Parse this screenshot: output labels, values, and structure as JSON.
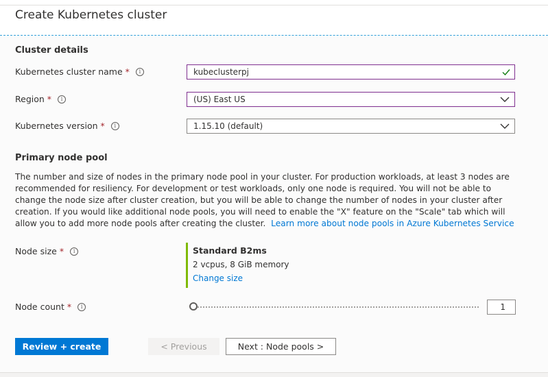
{
  "header": {
    "title": "Create Kubernetes cluster"
  },
  "cluster_details": {
    "section_title": "Cluster details",
    "name": {
      "label": "Kubernetes cluster name",
      "required_mark": "*",
      "value": "kubeclusterpj"
    },
    "region": {
      "label": "Region",
      "required_mark": "*",
      "value": "(US) East US"
    },
    "version": {
      "label": "Kubernetes version",
      "required_mark": "*",
      "value": "1.15.10 (default)"
    }
  },
  "primary_node_pool": {
    "section_title": "Primary node pool",
    "description": "The number and size of nodes in the primary node pool in your cluster. For production workloads, at least 3 nodes are recommended for resiliency. For development or test workloads, only one node is required. You will not be able to change the node size after cluster creation, but you will be able to change the number of nodes in your cluster after creation. If you would like additional node pools, you will need to enable the \"X\" feature on the \"Scale\" tab which will allow you to add more node pools after creating the cluster.",
    "learn_more_link": "Learn more about node pools in Azure Kubernetes Service",
    "node_size": {
      "label": "Node size",
      "required_mark": "*",
      "size_name": "Standard B2ms",
      "size_spec": "2 vcpus, 8 GiB memory",
      "change_link": "Change size"
    },
    "node_count": {
      "label": "Node count",
      "required_mark": "*",
      "value": "1",
      "slider_fraction": 0.0
    }
  },
  "footer": {
    "review_create": "Review + create",
    "previous": "< Previous",
    "next": "Next : Node pools >"
  },
  "icons": {
    "info": "info-icon",
    "valid": "check-icon",
    "dropdown": "chevron-down-icon"
  },
  "colors": {
    "accent": "#0078d4",
    "focus_border": "#7f2f8f",
    "valid_check": "#107c10",
    "node_size_bar": "#7fba00",
    "required": "#a4262c"
  }
}
